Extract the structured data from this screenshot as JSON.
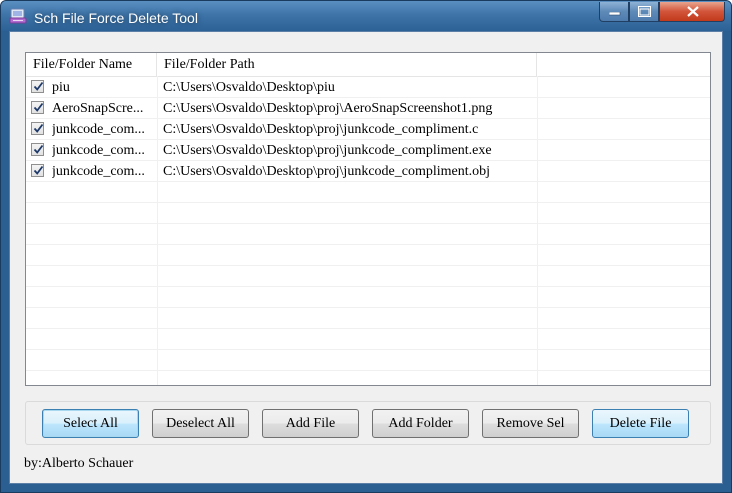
{
  "window": {
    "title": "Sch File Force Delete Tool"
  },
  "list": {
    "columns": [
      "File/Folder Name",
      "File/Folder Path"
    ],
    "rows": [
      {
        "checked": true,
        "name": "piu",
        "path": "C:\\Users\\Osvaldo\\Desktop\\piu"
      },
      {
        "checked": true,
        "name": "AeroSnapScre...",
        "path": "C:\\Users\\Osvaldo\\Desktop\\proj\\AeroSnapScreenshot1.png"
      },
      {
        "checked": true,
        "name": "junkcode_com...",
        "path": "C:\\Users\\Osvaldo\\Desktop\\proj\\junkcode_compliment.c"
      },
      {
        "checked": true,
        "name": "junkcode_com...",
        "path": "C:\\Users\\Osvaldo\\Desktop\\proj\\junkcode_compliment.exe"
      },
      {
        "checked": true,
        "name": "junkcode_com...",
        "path": "C:\\Users\\Osvaldo\\Desktop\\proj\\junkcode_compliment.obj"
      }
    ]
  },
  "buttons": {
    "select_all": "Select All",
    "deselect_all": "Deselect All",
    "add_file": "Add File",
    "add_folder": "Add Folder",
    "remove_sel": "Remove Sel",
    "delete_file": "Delete File"
  },
  "footer": {
    "author": "by:Alberto Schauer"
  },
  "icons": {
    "app": "app-icon",
    "minimize": "minimize-icon",
    "maximize": "maximize-icon",
    "close": "close-icon",
    "checkbox": "checkmark-icon"
  },
  "colors": {
    "titlebar": "#2c6196",
    "close_button": "#c23a1c",
    "focus_button": "#a7d9f5"
  }
}
